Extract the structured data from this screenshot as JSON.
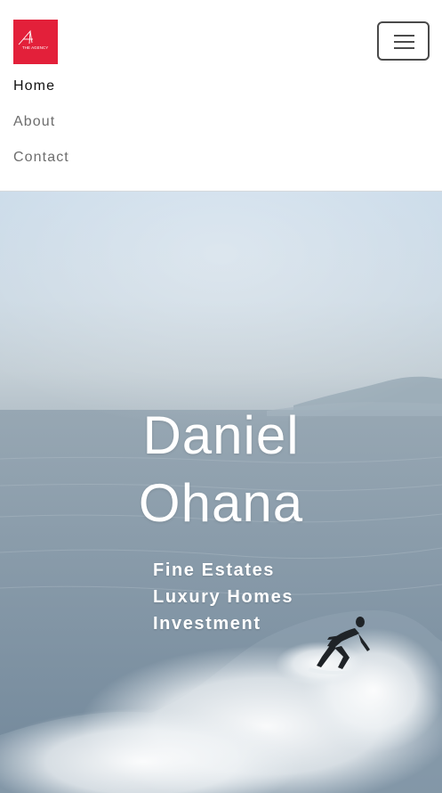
{
  "brand": {
    "logo_text": "THE AGENCY",
    "logo_color": "#e3203a",
    "logo_icon": "agency-a-mark-icon"
  },
  "navbar": {
    "toggler_icon": "hamburger-menu-icon",
    "items": [
      {
        "label": "Home",
        "active": true
      },
      {
        "label": "About",
        "active": false
      },
      {
        "label": "Contact",
        "active": false
      }
    ]
  },
  "hero": {
    "title_line1": "Daniel",
    "title_line2": "Ohana",
    "taglines": [
      "Fine Estates",
      "Luxury Homes",
      "Investment"
    ]
  }
}
